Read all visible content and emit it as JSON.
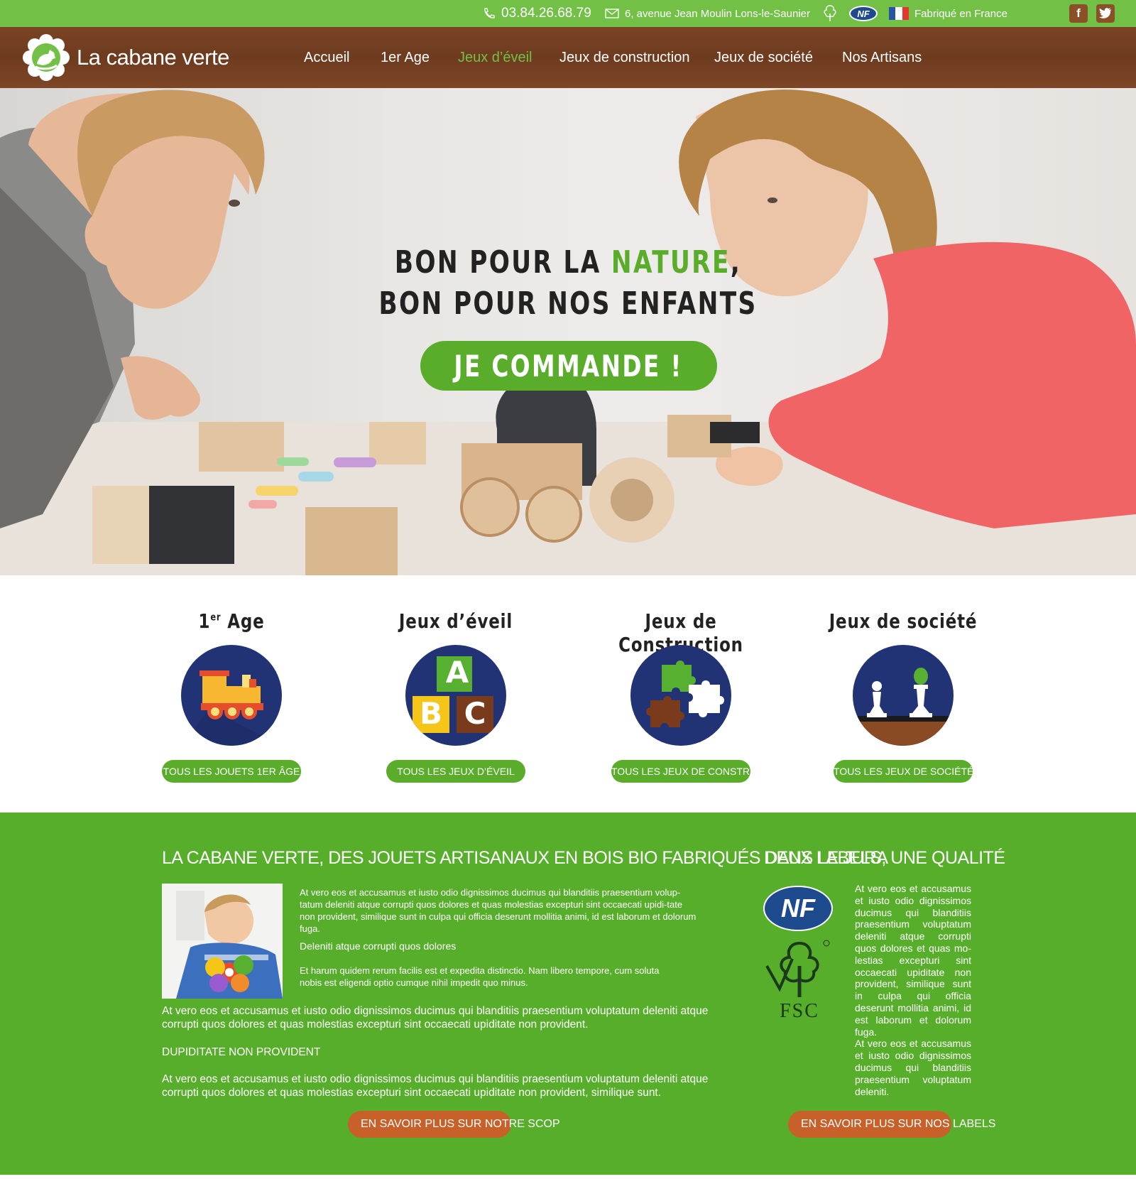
{
  "topbar": {
    "phone": "03.84.26.68.79",
    "address": "6, avenue Jean Moulin Lons-le-Saunier",
    "nf_badge": "NF",
    "made_in": "Fabriqué en France",
    "facebook_icon": "f",
    "colors": {
      "background": "#72c046"
    }
  },
  "nav": {
    "brand": "La cabane verte",
    "items": [
      {
        "label": "Accueil"
      },
      {
        "label": "1er Age"
      },
      {
        "label": "Jeux d’éveil"
      },
      {
        "label": "Jeux de construction"
      },
      {
        "label": "Jeux de société"
      },
      {
        "label": "Nos Artisans"
      }
    ],
    "active_item": "Jeux d’éveil",
    "colors": {
      "active": "#72c046",
      "background": "#6e3b1f"
    }
  },
  "hero": {
    "line1_a": "BON POUR LA ",
    "line1_accent": "NATURE",
    "line1_b": ",",
    "line2": "BON POUR NOS ENFANTS",
    "cta": "JE COMMANDE !"
  },
  "categories": [
    {
      "title": "1",
      "sup": "er",
      "title_rest": " Age",
      "button": "TOUS LES JOUETS 1ER ÂGE",
      "icon": "toy-train-icon"
    },
    {
      "title": "Jeux d’éveil",
      "button": "TOUS LES JEUX D’ÉVEIL",
      "icon": "abc-blocks-icon",
      "letters": [
        "A",
        "B",
        "C"
      ]
    },
    {
      "title": "Jeux de Construction",
      "button": "TOUS LES JEUX DE CONSTRUCTION",
      "icon": "puzzle-icon"
    },
    {
      "title": "Jeux de société",
      "button": "TOUS LES JEUX DE SOCIÉTÉ",
      "icon": "chess-icon"
    }
  ],
  "about": {
    "title": "LA CABANE VERTE, DES JOUETS ARTISANAUX EN BOIS BIO FABRIQUÉS DANS LE JURA",
    "p1": "At vero eos et accusamus et iusto odio dignissimos ducimus qui blanditiis praesentium volup-tatum deleniti atque corrupti quos dolores et quas molestias excepturi sint occaecati upidi-tate non provident, similique sunt in culpa qui officia deserunt mollitia animi, id est laborum et dolorum fuga.",
    "subtitle": "Deleniti atque corrupti quos dolores",
    "p2": "Et harum quidem rerum facilis est et expedita distinctio. Nam libero tempore, cum soluta nobis est eligendi optio cumque nihil impedit quo minus.",
    "p3": "At vero eos et accusamus et iusto odio dignissimos ducimus qui blanditiis praesentium voluptatum deleniti atque corrupti quos dolores et quas molestias excepturi sint occaecati upiditate non provident.",
    "heading2": "DUPIDITATE NON PROVIDENT",
    "p4": "At vero eos et accusamus et iusto odio dignissimos ducimus qui blanditiis praesentium voluptatum deleniti atque corrupti quos dolores et quas molestias excepturi sint occaecati upiditate non provident, similique sunt.",
    "button": "EN SAVOIR PLUS SUR NOTRE SCOP"
  },
  "labels": {
    "title": "DEUX LABELS, UNE QUALITÉ",
    "nf": "NF",
    "fsc": "FSC",
    "text": "At vero eos et accusamus et iusto odio dignissimos ducimus qui blanditiis praesentium voluptatum deleniti atque corrupti quos dolores et quas mo-lestias excepturi sint occaecati upiditate non provident, similique sunt in culpa qui officia deserunt mollitia animi, id est laborum et dolorum fuga.",
    "text2": "At vero eos et accusamus et iusto odio dignissimos ducimus qui blanditiis praesentium voluptatum deleniti.",
    "button": "EN SAVOIR PLUS SUR NOS LABELS"
  },
  "colors": {
    "green": "#57ae2b",
    "button_green": "#59ad2a",
    "orange": "#c8602a",
    "navy": "#213375"
  }
}
